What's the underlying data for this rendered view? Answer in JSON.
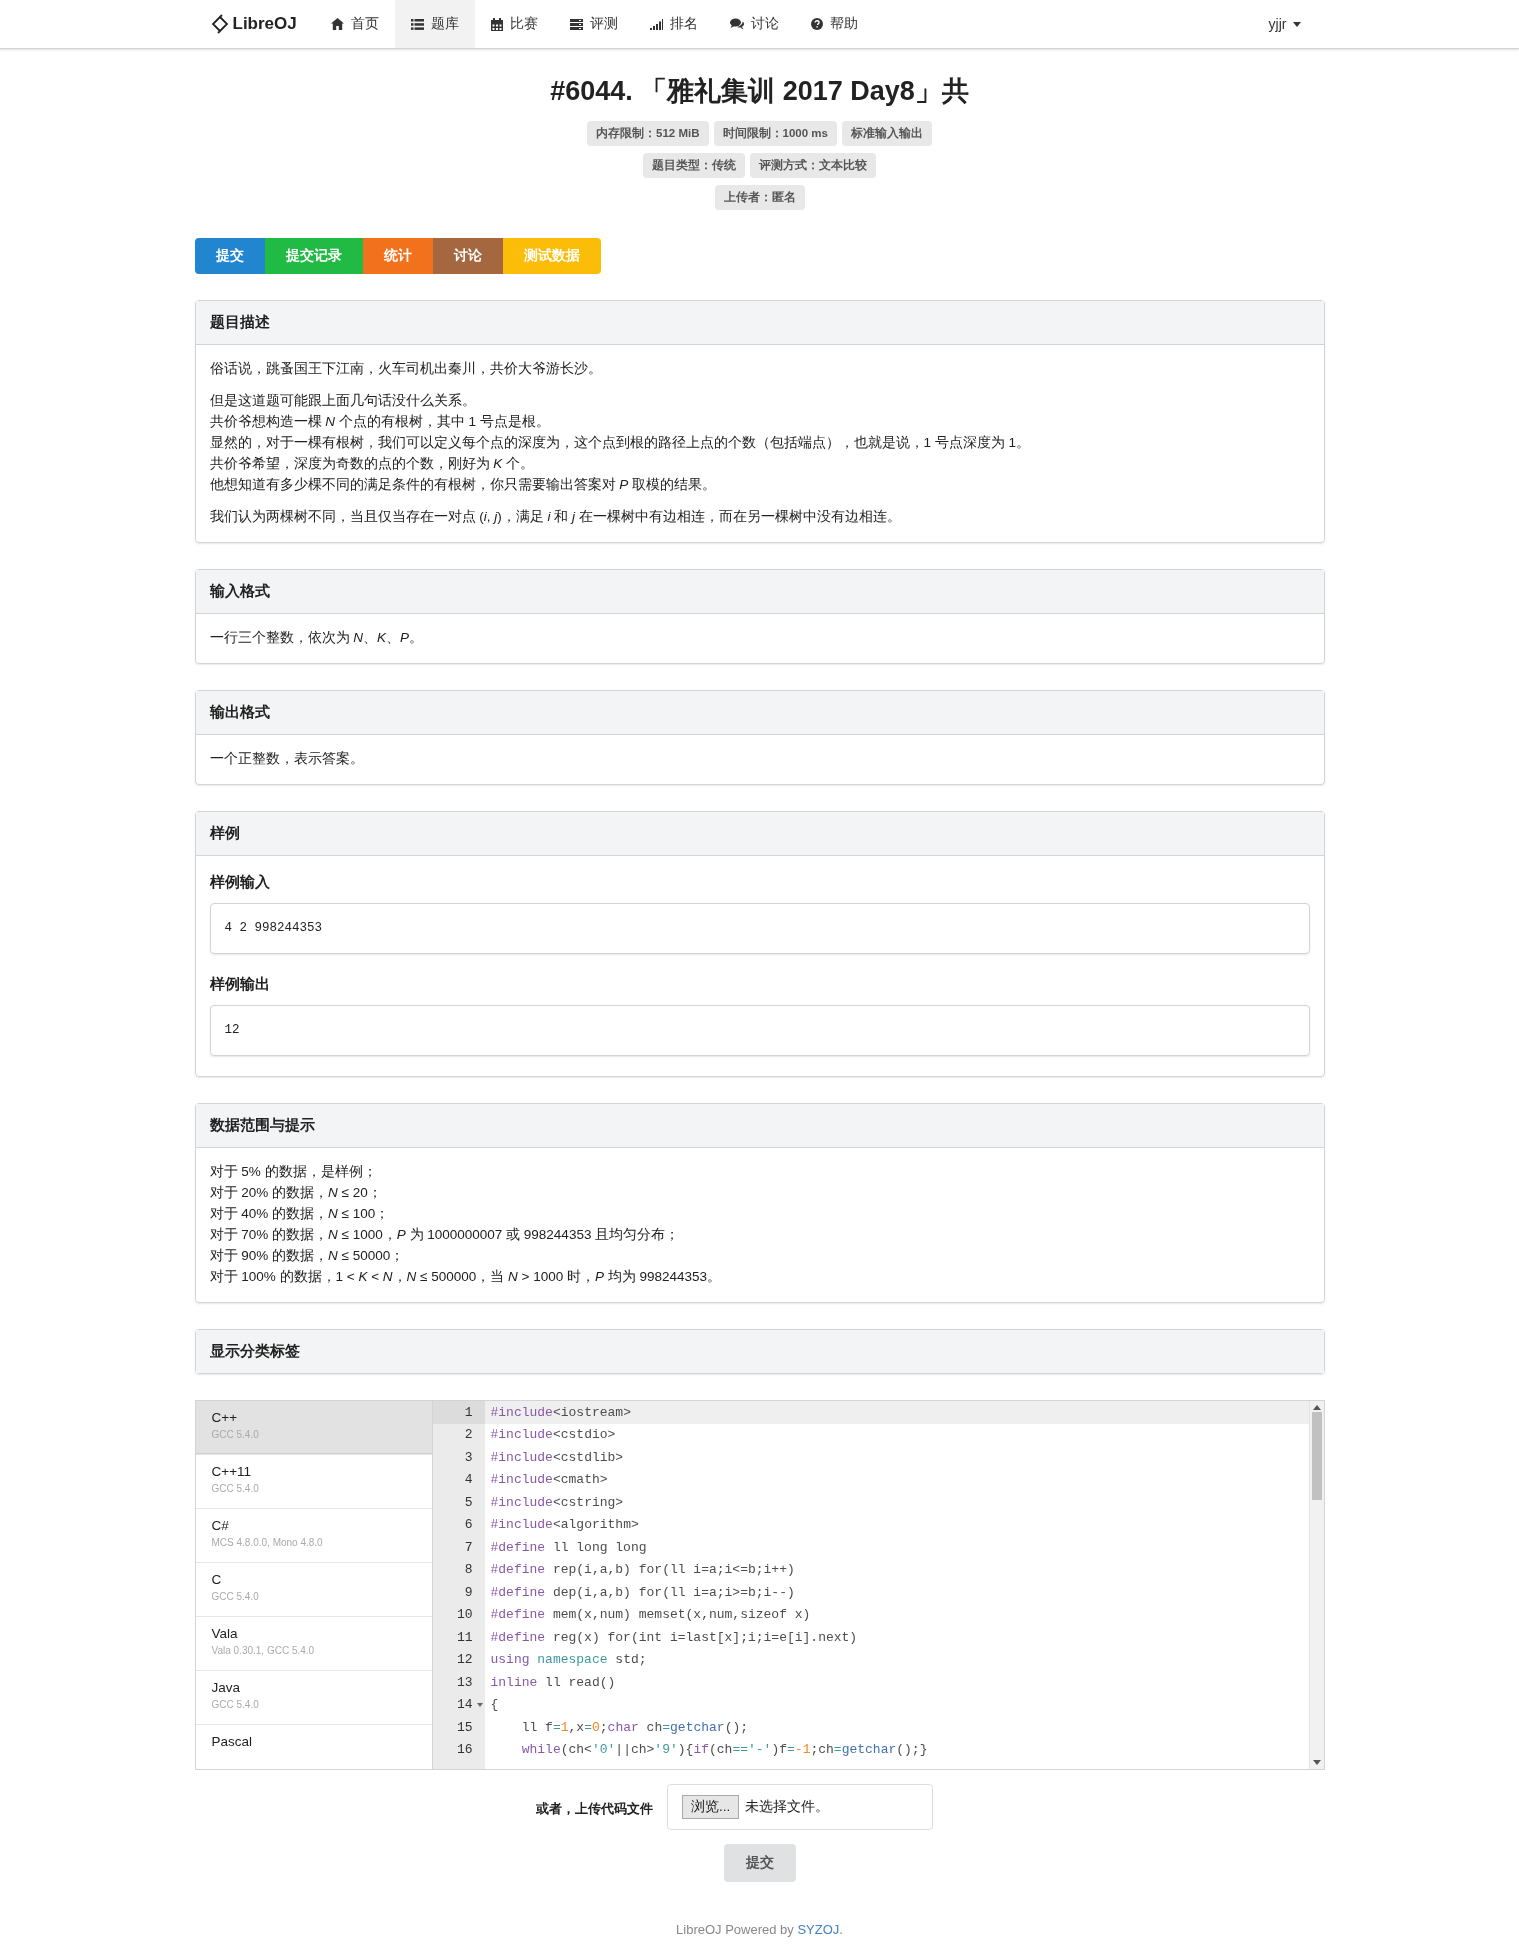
{
  "nav": {
    "brand": "LibreOJ",
    "items": [
      {
        "label": "首页",
        "kind": "home",
        "selected": false
      },
      {
        "label": "题库",
        "kind": "list",
        "selected": true
      },
      {
        "label": "比赛",
        "kind": "calendar",
        "selected": false
      },
      {
        "label": "评测",
        "kind": "server",
        "selected": false
      },
      {
        "label": "排名",
        "kind": "signal",
        "selected": false
      },
      {
        "label": "讨论",
        "kind": "comments",
        "selected": false
      },
      {
        "label": "帮助",
        "kind": "help",
        "selected": false
      }
    ],
    "user": "yjjr"
  },
  "title": "#6044. 「雅礼集训 2017 Day8」共",
  "badge_rows": [
    [
      "内存限制：512 MiB",
      "时间限制：1000 ms",
      "标准输入输出"
    ],
    [
      "题目类型：传统",
      "评测方式：文本比较"
    ],
    [
      "上传者：匿名"
    ]
  ],
  "action_buttons": [
    {
      "label": "提交",
      "color": "#2185d0"
    },
    {
      "label": "提交记录",
      "color": "#21ba45"
    },
    {
      "label": "统计",
      "color": "#f2711c"
    },
    {
      "label": "讨论",
      "color": "#a5673f"
    },
    {
      "label": "测试数据",
      "color": "#fbbd08"
    }
  ],
  "sections": [
    {
      "kind": "text",
      "title": "题目描述",
      "paragraphs": [
        [
          "俗话说，跳蚤国王下江南，火车司机出秦川，共价大爷游长沙。"
        ],
        [
          "但是这道题可能跟上面几句话没什么关系。",
          "共价爷想构造一棵 *N* 个点的有根树，其中 1 号点是根。",
          "显然的，对于一棵有根树，我们可以定义每个点的深度为，这个点到根的路径上点的个数（包括端点），也就是说，1 号点深度为 1。",
          "共价爷希望，深度为奇数的点的个数，刚好为 *K* 个。",
          "他想知道有多少棵不同的满足条件的有根树，你只需要输出答案对 *P* 取模的结果。"
        ],
        [
          "我们认为两棵树不同，当且仅当存在一对点 (*i*, *j*)，满足 *i* 和 *j* 在一棵树中有边相连，而在另一棵树中没有边相连。"
        ]
      ]
    },
    {
      "kind": "text",
      "title": "输入格式",
      "paragraphs": [
        [
          "一行三个整数，依次为 *N*、*K*、*P*。"
        ]
      ]
    },
    {
      "kind": "text",
      "title": "输出格式",
      "paragraphs": [
        [
          "一个正整数，表示答案。"
        ]
      ]
    },
    {
      "kind": "samples",
      "title": "样例",
      "samples": [
        {
          "title": "样例输入",
          "code": "4 2 998244353"
        },
        {
          "title": "样例输出",
          "code": "12"
        }
      ]
    },
    {
      "kind": "text",
      "title": "数据范围与提示",
      "paragraphs": [
        [
          "对于 5% 的数据，是样例；",
          "对于 20% 的数据，*N* ≤ 20；",
          "对于 40% 的数据，*N* ≤ 100；",
          "对于 70% 的数据，*N* ≤ 1000，*P* 为 1000000007 或 998244353 且均匀分布；",
          "对于 90% 的数据，*N* ≤ 50000；",
          "对于 100% 的数据，1 < *K* < *N*，*N* ≤ 500000，当 *N* > 1000 时，*P* 均为 998244353。"
        ]
      ]
    },
    {
      "kind": "toggle",
      "title": "显示分类标签"
    }
  ],
  "editor": {
    "languages": [
      {
        "name": "C++",
        "version": "GCC 5.4.0",
        "selected": true
      },
      {
        "name": "C++11",
        "version": "GCC 5.4.0",
        "selected": false
      },
      {
        "name": "C#",
        "version": "MCS 4.8.0.0, Mono 4.8.0",
        "selected": false
      },
      {
        "name": "C",
        "version": "GCC 5.4.0",
        "selected": false
      },
      {
        "name": "Vala",
        "version": "Vala 0.30.1, GCC 5.4.0",
        "selected": false
      },
      {
        "name": "Java",
        "version": "GCC 5.4.0",
        "selected": false
      },
      {
        "name": "Pascal",
        "selected": false
      }
    ],
    "lines": [
      {
        "number": "1",
        "active": true,
        "foldable": false,
        "tokens": [
          {
            "text": "#include",
            "kind": "meta"
          },
          {
            "text": "<iostream>",
            "kind": "plain"
          }
        ]
      },
      {
        "number": "2",
        "active": false,
        "foldable": false,
        "tokens": [
          {
            "text": "#include",
            "kind": "meta"
          },
          {
            "text": "<cstdio>",
            "kind": "plain"
          }
        ]
      },
      {
        "number": "3",
        "active": false,
        "foldable": false,
        "tokens": [
          {
            "text": "#include",
            "kind": "meta"
          },
          {
            "text": "<cstdlib>",
            "kind": "plain"
          }
        ]
      },
      {
        "number": "4",
        "active": false,
        "foldable": false,
        "tokens": [
          {
            "text": "#include",
            "kind": "meta"
          },
          {
            "text": "<cmath>",
            "kind": "plain"
          }
        ]
      },
      {
        "number": "5",
        "active": false,
        "foldable": false,
        "tokens": [
          {
            "text": "#include",
            "kind": "meta"
          },
          {
            "text": "<cstring>",
            "kind": "plain"
          }
        ]
      },
      {
        "number": "6",
        "active": false,
        "foldable": false,
        "tokens": [
          {
            "text": "#include",
            "kind": "meta"
          },
          {
            "text": "<algorithm>",
            "kind": "plain"
          }
        ]
      },
      {
        "number": "7",
        "active": false,
        "foldable": false,
        "tokens": [
          {
            "text": "#define",
            "kind": "meta"
          },
          {
            "text": " ll long long",
            "kind": "plain"
          }
        ]
      },
      {
        "number": "8",
        "active": false,
        "foldable": false,
        "tokens": [
          {
            "text": "#define",
            "kind": "meta"
          },
          {
            "text": " rep(i,a,b) for(ll i=a;i<=b;i++)",
            "kind": "plain"
          }
        ]
      },
      {
        "number": "9",
        "active": false,
        "foldable": false,
        "tokens": [
          {
            "text": "#define",
            "kind": "meta"
          },
          {
            "text": " dep(i,a,b) for(ll i=a;i>=b;i--)",
            "kind": "plain"
          }
        ]
      },
      {
        "number": "10",
        "active": false,
        "foldable": false,
        "tokens": [
          {
            "text": "#define",
            "kind": "meta"
          },
          {
            "text": " mem(x,num) memset(x,num,sizeof x)",
            "kind": "plain"
          }
        ]
      },
      {
        "number": "11",
        "active": false,
        "foldable": false,
        "tokens": [
          {
            "text": "#define",
            "kind": "meta"
          },
          {
            "text": " reg(x) for(int i=last[x];i;i=e[i].next)",
            "kind": "plain"
          }
        ]
      },
      {
        "number": "12",
        "active": false,
        "foldable": false,
        "tokens": [
          {
            "text": "using",
            "kind": "keyword"
          },
          {
            "text": " namespace",
            "kind": "type"
          },
          {
            "text": " std;",
            "kind": "plain"
          }
        ]
      },
      {
        "number": "13",
        "active": false,
        "foldable": false,
        "tokens": [
          {
            "text": "inline",
            "kind": "keyword"
          },
          {
            "text": " ll read()",
            "kind": "plain"
          }
        ]
      },
      {
        "number": "14",
        "active": false,
        "foldable": true,
        "tokens": [
          {
            "text": "{",
            "kind": "plain"
          }
        ]
      },
      {
        "number": "15",
        "active": false,
        "foldable": false,
        "tokens": [
          {
            "text": "    ll f",
            "kind": "plain"
          },
          {
            "text": "=",
            "kind": "operator"
          },
          {
            "text": "1",
            "kind": "number"
          },
          {
            "text": ",x",
            "kind": "plain"
          },
          {
            "text": "=",
            "kind": "operator"
          },
          {
            "text": "0",
            "kind": "number"
          },
          {
            "text": ";",
            "kind": "plain"
          },
          {
            "text": "char",
            "kind": "keyword"
          },
          {
            "text": " ch",
            "kind": "plain"
          },
          {
            "text": "=",
            "kind": "operator"
          },
          {
            "text": "getchar",
            "kind": "function"
          },
          {
            "text": "();",
            "kind": "plain"
          }
        ]
      },
      {
        "number": "16",
        "active": false,
        "foldable": false,
        "tokens": [
          {
            "text": "    while",
            "kind": "keyword"
          },
          {
            "text": "(ch<",
            "kind": "plain"
          },
          {
            "text": "'0'",
            "kind": "string"
          },
          {
            "text": "||ch>",
            "kind": "plain"
          },
          {
            "text": "'9'",
            "kind": "string"
          },
          {
            "text": "){",
            "kind": "plain"
          },
          {
            "text": "if",
            "kind": "keyword"
          },
          {
            "text": "(ch",
            "kind": "plain"
          },
          {
            "text": "==",
            "kind": "operator"
          },
          {
            "text": "'-'",
            "kind": "string"
          },
          {
            "text": ")f",
            "kind": "plain"
          },
          {
            "text": "=",
            "kind": "operator"
          },
          {
            "text": "-1",
            "kind": "number"
          },
          {
            "text": ";ch",
            "kind": "plain"
          },
          {
            "text": "=",
            "kind": "operator"
          },
          {
            "text": "getchar",
            "kind": "function"
          },
          {
            "text": "();}",
            "kind": "plain"
          }
        ]
      }
    ]
  },
  "upload": {
    "label": "或者，上传代码文件",
    "browse": "浏览...",
    "status": "未选择文件。",
    "submit": "提交"
  },
  "footer": {
    "text": "LibreOJ Powered by ",
    "link": "SYZOJ",
    "end": "."
  }
}
